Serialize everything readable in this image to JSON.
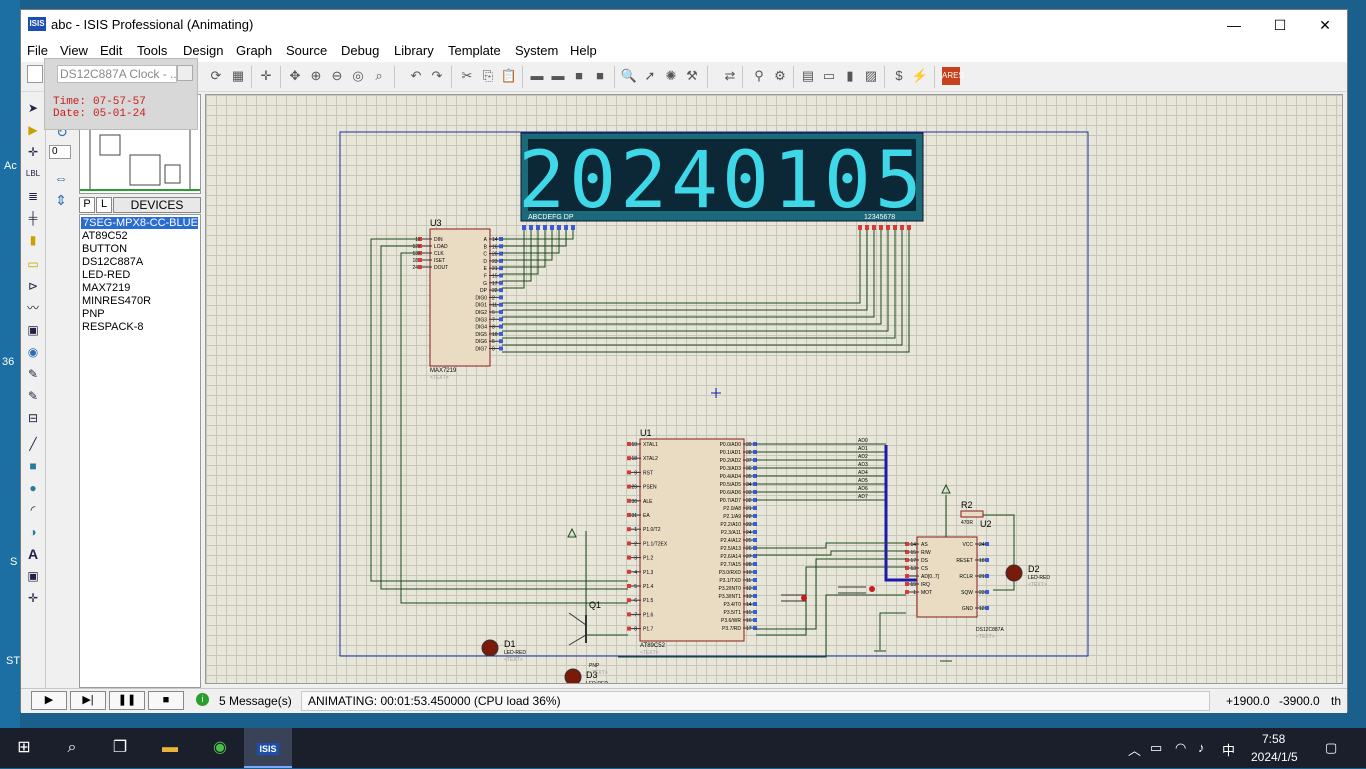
{
  "window": {
    "app_icon": "ISIS",
    "title": "abc - ISIS Professional (Animating)",
    "minimize": "—",
    "maximize": "☐",
    "close": "✕"
  },
  "menu": [
    "File",
    "View",
    "Edit",
    "Tools",
    "Design",
    "Graph",
    "Source",
    "Debug",
    "Library",
    "Template",
    "System",
    "Help"
  ],
  "popup": {
    "title": "DS12C887A Clock - ...",
    "time_label": "Time:",
    "time_value": "07-57-57",
    "date_label": "Date:",
    "date_value": "05-01-24"
  },
  "rotation_value": "0",
  "panel": {
    "tab_p": "P",
    "tab_l": "L",
    "header": "DEVICES",
    "devices": [
      "7SEG-MPX8-CC-BLUE",
      "AT89C52",
      "BUTTON",
      "DS12C887A",
      "LED-RED",
      "MAX7219",
      "MINRES470R",
      "PNP",
      "RESPACK-8"
    ],
    "selected_index": 0
  },
  "display": {
    "digits": "20240105",
    "left_pins": "ABCDEFG  DP",
    "right_pins": "12345678",
    "color": "#3fd8e8"
  },
  "schematic": {
    "u3_ref": "U3",
    "u3_part": "MAX7219",
    "u3_text": "<TEXT>",
    "u3_left_pins": [
      "DIN",
      "LOAD",
      "CLK",
      "ISET",
      "DOUT"
    ],
    "u3_left_nums": [
      "1",
      "12",
      "13",
      "18",
      "24"
    ],
    "u3_right_pins": [
      "A",
      "B",
      "C",
      "D",
      "E",
      "F",
      "G",
      "DP",
      "DIG0",
      "DIG1",
      "DIG2",
      "DIG3",
      "DIG4",
      "DIG5",
      "DIG6",
      "DIG7"
    ],
    "u3_right_nums": [
      "14",
      "16",
      "20",
      "23",
      "21",
      "15",
      "17",
      "22",
      "2",
      "11",
      "6",
      "7",
      "3",
      "10",
      "5",
      "8"
    ],
    "u1_ref": "U1",
    "u1_part": "AT89C52",
    "u1_text": "<TEXT>",
    "u1_left_pins": [
      "XTAL1",
      "XTAL2",
      "RST",
      "PSEN",
      "ALE",
      "EA",
      "P1.0/T2",
      "P1.1/T2EX",
      "P1.2",
      "P1.3",
      "P1.4",
      "P1.5",
      "P1.6",
      "P1.7"
    ],
    "u1_left_nums": [
      "19",
      "18",
      "9",
      "29",
      "30",
      "31",
      "1",
      "2",
      "3",
      "4",
      "5",
      "6",
      "7",
      "8"
    ],
    "u1_right_pins": [
      "P0.0/AD0",
      "P0.1/AD1",
      "P0.2/AD2",
      "P0.3/AD3",
      "P0.4/AD4",
      "P0.5/AD5",
      "P0.6/AD6",
      "P0.7/AD7",
      "P2.0/A8",
      "P2.1/A9",
      "P2.2/A10",
      "P2.3/A11",
      "P2.4/A12",
      "P2.5/A13",
      "P2.6/A14",
      "P2.7/A15",
      "P3.0/RXD",
      "P3.1/TXD",
      "P3.2/INT0",
      "P3.3/INT1",
      "P3.4/T0",
      "P3.5/T1",
      "P3.6/WR",
      "P3.7/RD"
    ],
    "u1_right_nums": [
      "39",
      "38",
      "37",
      "36",
      "35",
      "34",
      "33",
      "32",
      "21",
      "22",
      "23",
      "24",
      "25",
      "26",
      "27",
      "28",
      "10",
      "11",
      "12",
      "13",
      "14",
      "15",
      "16",
      "17"
    ],
    "bus_labels": [
      "AD0",
      "AD1",
      "AD2",
      "AD3",
      "AD4",
      "AD5",
      "AD6",
      "AD7"
    ],
    "u2_ref": "U2",
    "u2_part": "DS12C887A",
    "u2_text": "<TEXT>",
    "u2_left_pins": [
      "AS",
      "R/W",
      "DS",
      "CS",
      "AD[0..7]",
      "IRQ",
      "MOT"
    ],
    "u2_left_nums": [
      "14",
      "15",
      "17",
      "13",
      "",
      "19",
      "1"
    ],
    "u2_right_pins": [
      "VCC",
      "RESET",
      "RCLR",
      "SQW",
      "GND"
    ],
    "u2_right_nums": [
      "24",
      "18",
      "21",
      "23",
      "12"
    ],
    "r2_ref": "R2",
    "r2_value": "470R",
    "d1_ref": "D1",
    "d2_ref": "D2",
    "d3_ref": "D3",
    "led_part": "LED-RED",
    "q1_ref": "Q1",
    "q1_part": "PNP",
    "text_placeholder": "<TEXT>"
  },
  "status": {
    "messages": "5 Message(s)",
    "animating": "ANIMATING: 00:01:53.450000 (CPU load 36%)",
    "x": "+1900.0",
    "y": "-3900.0",
    "unit": "th"
  },
  "taskbar": {
    "time": "7:58",
    "date": "2024/1/5",
    "ime": "中"
  },
  "desktop_fragments": [
    "Ac",
    "36",
    "S",
    "ST"
  ]
}
